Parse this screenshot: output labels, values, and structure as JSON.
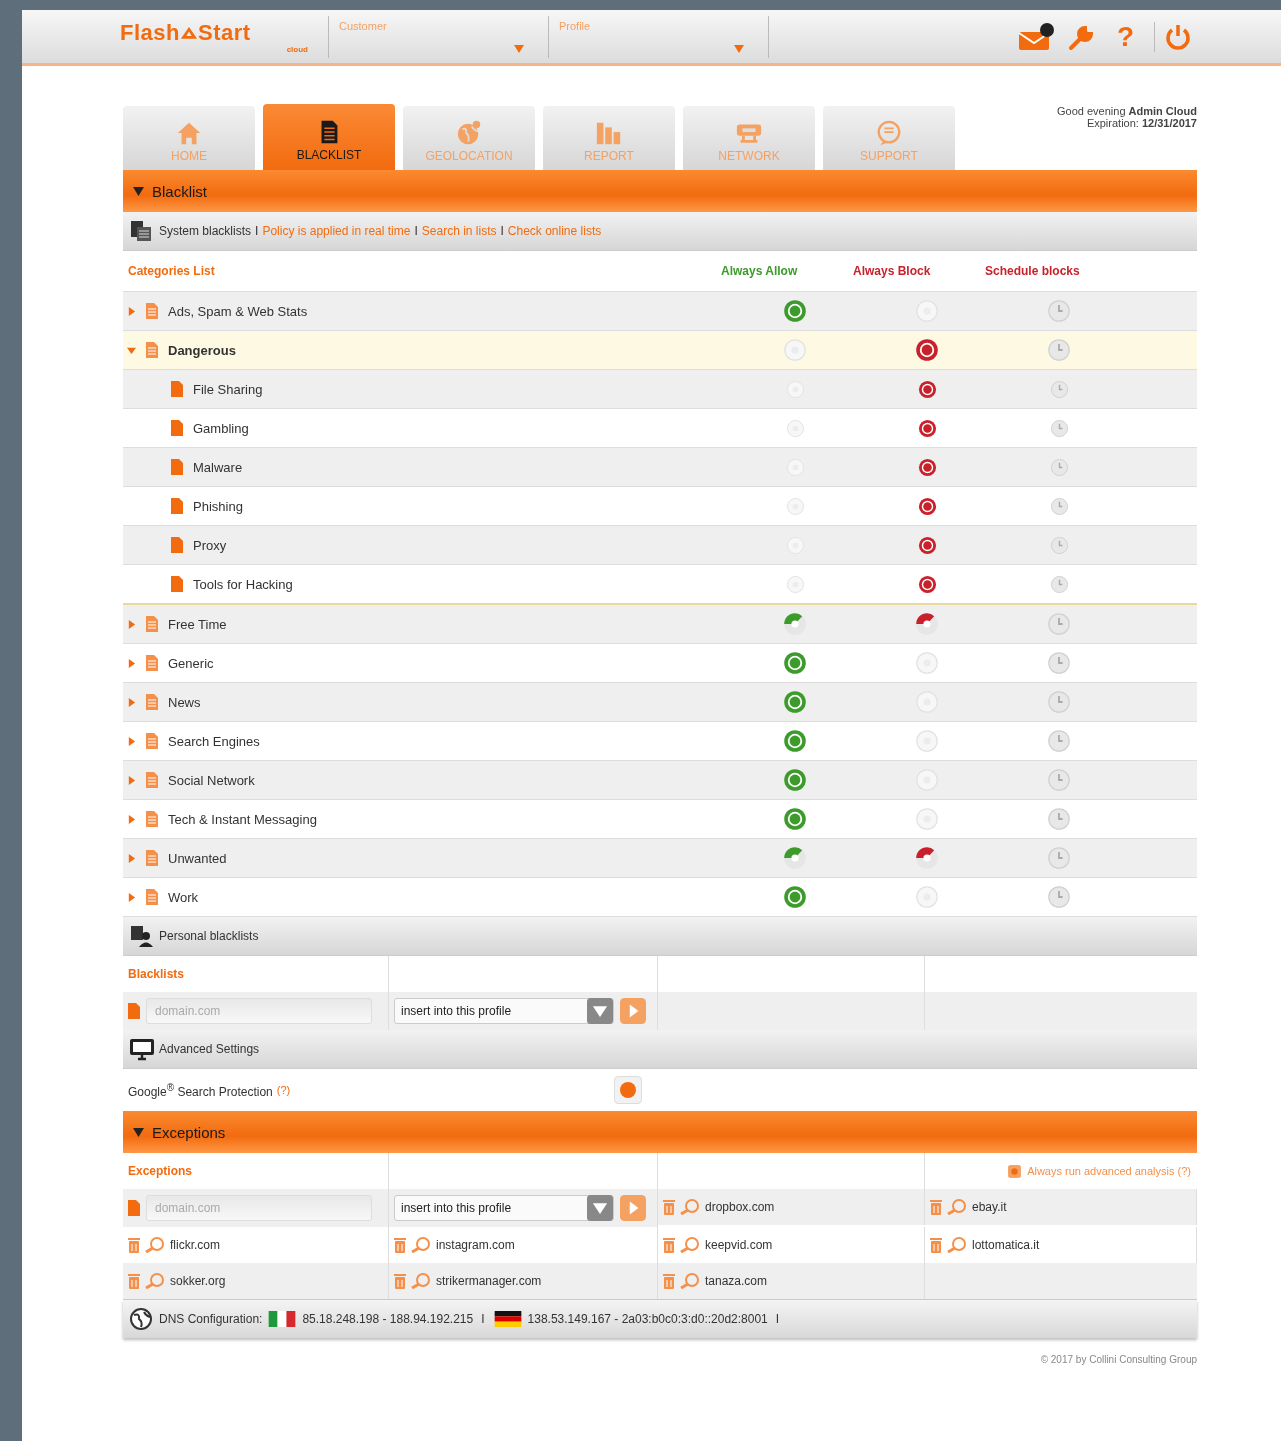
{
  "header": {
    "logo": {
      "first": "Flash",
      "second": "Start",
      "sub": "cloud"
    },
    "customer_label": "Customer",
    "profile_label": "Profile",
    "help": "?"
  },
  "tabs": [
    {
      "label": "HOME",
      "kind": "home",
      "selected": false
    },
    {
      "label": "BLACKLIST",
      "kind": "document",
      "selected": true
    },
    {
      "label": "GEOLOCATION",
      "kind": "globe",
      "selected": false
    },
    {
      "label": "REPORT",
      "kind": "bars",
      "selected": false
    },
    {
      "label": "NETWORK",
      "kind": "router",
      "selected": false
    },
    {
      "label": "SUPPORT",
      "kind": "chat",
      "selected": false
    }
  ],
  "greeting": {
    "text": "Good evening",
    "user": "Admin Cloud",
    "expiration_label": "Expiration:",
    "expiration": "12/31/2017"
  },
  "blacklist": {
    "title": "Blacklist",
    "expanded": true,
    "system_label": "System blacklists",
    "links": [
      {
        "separator": "I",
        "label": "Policy is applied in real time"
      },
      {
        "separator": "I",
        "label": "Search in lists"
      },
      {
        "separator": "I",
        "label": "Check online lists"
      }
    ],
    "columns": [
      "Categories List",
      "Always Allow",
      "Always Block",
      "Schedule blocks"
    ],
    "categories": [
      {
        "name": "Ads, Spam & Web Stats",
        "expanded": false,
        "mixed": false,
        "allow": true,
        "block": false
      },
      {
        "name": "Dangerous",
        "expanded": true,
        "mixed": false,
        "allow": false,
        "block": true,
        "children": [
          {
            "name": "File Sharing",
            "allow": false,
            "block": true
          },
          {
            "name": "Gambling",
            "allow": false,
            "block": true
          },
          {
            "name": "Malware",
            "allow": false,
            "block": true
          },
          {
            "name": "Phishing",
            "allow": false,
            "block": true
          },
          {
            "name": "Proxy",
            "allow": false,
            "block": true
          },
          {
            "name": "Tools for Hacking",
            "allow": false,
            "block": true
          }
        ]
      },
      {
        "name": "Free Time",
        "expanded": false,
        "mixed": true
      },
      {
        "name": "Generic",
        "expanded": false,
        "mixed": false,
        "allow": true,
        "block": false
      },
      {
        "name": "News",
        "expanded": false,
        "mixed": false,
        "allow": true,
        "block": false
      },
      {
        "name": "Search Engines",
        "expanded": false,
        "mixed": false,
        "allow": true,
        "block": false
      },
      {
        "name": "Social Network",
        "expanded": false,
        "mixed": false,
        "allow": true,
        "block": false
      },
      {
        "name": "Tech & Instant Messaging",
        "expanded": false,
        "mixed": false,
        "allow": true,
        "block": false
      },
      {
        "name": "Unwanted",
        "expanded": false,
        "mixed": true
      },
      {
        "name": "Work",
        "expanded": false,
        "mixed": false,
        "allow": true,
        "block": false
      }
    ]
  },
  "personal": {
    "title": "Personal blacklists",
    "column": "Blacklists",
    "placeholder": "domain.com",
    "select": "insert into this profile"
  },
  "advanced": {
    "title": "Advanced Settings",
    "setting": "Google$^{®}$ Search Protection",
    "help": "(?)",
    "on": true
  },
  "exceptions": {
    "title": "Exceptions",
    "expanded": true,
    "column": "Exceptions",
    "analysis": "Always run advanced analysis (?)",
    "analysis_checked": true,
    "placeholder": "domain.com",
    "select": "insert into this profile",
    "domains": [
      "dropbox.com",
      "ebay.it",
      "flickr.com",
      "instagram.com",
      "keepvid.com",
      "lottomatica.it",
      "sokker.org",
      "strikermanager.com",
      "tanaza.com"
    ]
  },
  "dns": {
    "label": "DNS Configuration:",
    "servers": [
      {
        "kind": "italy",
        "addresses": "85.18.248.198 - 188.94.192.215",
        "separator": "I"
      },
      {
        "kind": "germany",
        "addresses": "138.53.149.167 - 2a03:b0c0:3:d0::20d2:8001",
        "separator": "I"
      }
    ]
  },
  "footer": "© 2017 by Collini Consulting Group"
}
